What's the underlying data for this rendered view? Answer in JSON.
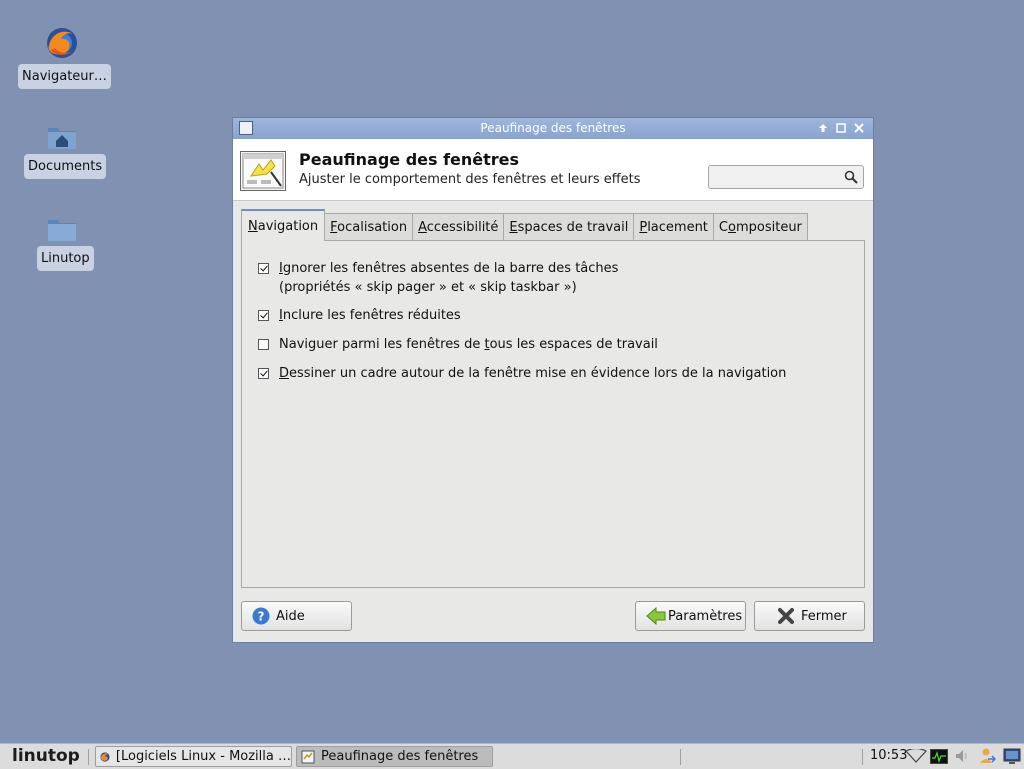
{
  "desktop": {
    "icons": [
      {
        "label": "Navigateur…"
      },
      {
        "label": "Documents"
      },
      {
        "label": "Linutop"
      }
    ]
  },
  "window": {
    "title": "Peaufinage des fenêtres",
    "header_title": "Peaufinage des fenêtres",
    "header_subtitle": "Ajuster le comportement des fenêtres et leurs effets",
    "search_placeholder": "",
    "tabs": [
      {
        "label": "Navigation",
        "mnemonic": "N",
        "rest": "avigation",
        "active": true
      },
      {
        "label": "Focalisation",
        "mnemonic": "F",
        "rest": "ocalisation"
      },
      {
        "label": "Accessibilité",
        "mnemonic": "A",
        "rest": "ccessibilité"
      },
      {
        "label": "Espaces de travail",
        "mnemonic": "E",
        "rest": "spaces de travail"
      },
      {
        "label": "Placement",
        "mnemonic": "P",
        "rest": "lacement"
      },
      {
        "label": "Compositeur",
        "pre": "C",
        "mnemonic": "o",
        "rest": "mpositeur"
      }
    ],
    "options": [
      {
        "pre": "",
        "mn": "I",
        "post": "gnorer les fenêtres absentes de la barre des tâches",
        "line2": "(propriétés « skip pager » et « skip taskbar »)",
        "checked": true
      },
      {
        "pre": "",
        "mn": "I",
        "post": "nclure les fenêtres réduites",
        "checked": true
      },
      {
        "pre": "Naviguer parmi les fenêtres de ",
        "mn": "t",
        "post": "ous les espaces de travail",
        "checked": false
      },
      {
        "pre": "",
        "mn": "D",
        "post": "essiner un cadre autour de la fenêtre mise en évidence lors de la navigation",
        "checked": true
      }
    ],
    "buttons": {
      "help": "Aide",
      "settings": "Paramètres",
      "close": "Fermer"
    }
  },
  "taskbar": {
    "logo": "linutop",
    "tasks": [
      {
        "label": "[Logiciels Linux - Mozilla …"
      },
      {
        "label": "Peaufinage des fenêtres"
      }
    ],
    "clock": "10:53"
  },
  "colors": {
    "desktop_bg": "#8091b1",
    "titlebar": "#8aa3cd",
    "active_tab_accent": "#6d8fc7"
  }
}
